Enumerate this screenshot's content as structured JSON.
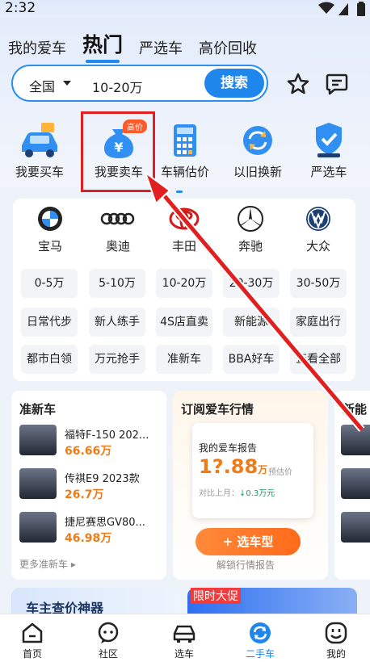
{
  "status": {
    "time": "2:32"
  },
  "tabs": [
    {
      "label": "我的爱车"
    },
    {
      "label": "热门"
    },
    {
      "label": "严选车"
    },
    {
      "label": "高价回收"
    }
  ],
  "search": {
    "region": "全国",
    "query": "10-20万",
    "button": "搜索"
  },
  "quick_actions": [
    {
      "label": "我要买车",
      "icon": "car-icon"
    },
    {
      "label": "我要卖车",
      "icon": "money-bag-icon",
      "badge": "高价"
    },
    {
      "label": "车辆估价",
      "icon": "calculator-icon"
    },
    {
      "label": "以旧换新",
      "icon": "exchange-icon"
    },
    {
      "label": "严选车",
      "icon": "shield-check-icon"
    }
  ],
  "brands": [
    {
      "label": "宝马"
    },
    {
      "label": "奥迪"
    },
    {
      "label": "丰田"
    },
    {
      "label": "奔驰"
    },
    {
      "label": "大众"
    }
  ],
  "price_filters": [
    "0-5万",
    "5-10万",
    "10-20万",
    "20-30万",
    "30-50万"
  ],
  "tag_filters": [
    "日常代步",
    "新人练手",
    "4S店直卖",
    "新能源",
    "家庭出行",
    "都市白领",
    "万元抢手",
    "准新车",
    "BBA好车",
    "查看全部"
  ],
  "near_new": {
    "title": "准新车",
    "cars": [
      {
        "name": "福特F-150 202...",
        "price": "66.66万"
      },
      {
        "name": "传祺E9 2023款",
        "price": "26.7万"
      },
      {
        "name": "捷尼赛思GV80...",
        "price": "46.98万"
      }
    ],
    "more": "更多准新车"
  },
  "subscribe": {
    "title": "订阅爱车行情",
    "report_title": "我的爱车报告",
    "report_value": "1?.88",
    "report_unit": "万",
    "report_estimate": "预估价",
    "report_change_label": "对比上月：",
    "report_change": "↓0.3万元",
    "button": "+ 选车型",
    "unlock": "解锁行情报告"
  },
  "third_section": {
    "title": "新能"
  },
  "bottom_cards": {
    "left": "车主查价神器",
    "right": "限时大促"
  },
  "navbar": [
    {
      "label": "首页",
      "icon": "home-icon"
    },
    {
      "label": "社区",
      "icon": "chat-icon"
    },
    {
      "label": "选车",
      "icon": "car-select-icon"
    },
    {
      "label": "二手车",
      "icon": "used-car-icon",
      "active": true
    },
    {
      "label": "我的",
      "icon": "profile-icon"
    }
  ],
  "colors": {
    "accent": "#1f86ec",
    "price": "#f07a14",
    "highlight": "#e02020"
  }
}
